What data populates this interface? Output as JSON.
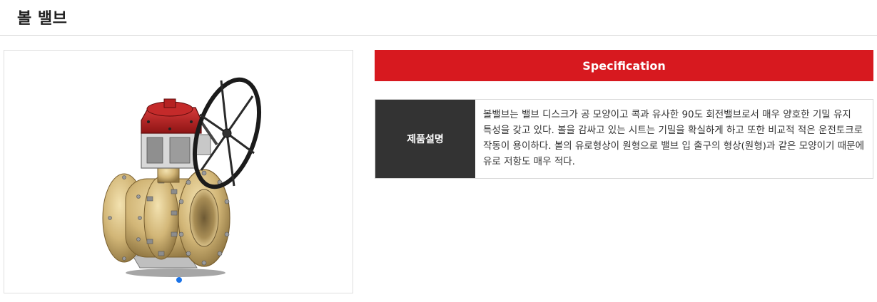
{
  "page": {
    "title": "볼 밸브"
  },
  "gallery": {
    "image_subject": "ball-valve-with-handwheel",
    "pagination": {
      "current": 1,
      "total": 1
    },
    "dot_color": "#1a73e8"
  },
  "spec": {
    "header": "Specification",
    "header_color": "#d7191f",
    "rows": [
      {
        "label": "제품설명",
        "value": "볼밸브는 밸브 디스크가 공 모양이고 콕과 유사한 90도 회전밸브로서 매우 양호한 기밀 유지 특성을 갖고 있다. 볼을 감싸고 있는 시트는 기밀을 확실하게 하고 또한 비교적 적은 운전토크로 작동이 용이하다. 볼의 유로형상이 원형으로 밸브 입 출구의 형상(원형)과 같은 모양이기 때문에 유로 저항도 매우 적다."
      }
    ]
  }
}
